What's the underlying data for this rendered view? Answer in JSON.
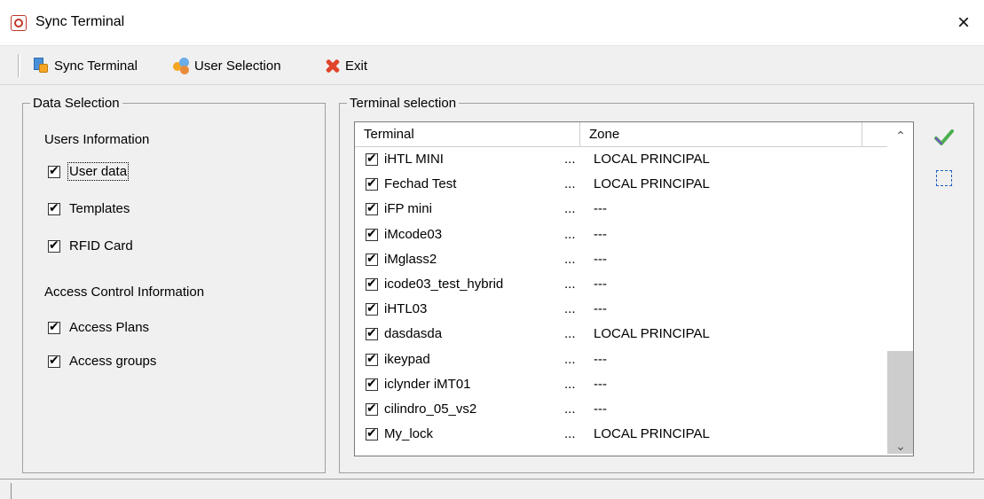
{
  "window": {
    "title": "Sync Terminal",
    "close_glyph": "×"
  },
  "toolbar": {
    "items": [
      {
        "label": "Sync Terminal",
        "icon": "sync-terminal-icon"
      },
      {
        "label": "User Selection",
        "icon": "users-icon"
      },
      {
        "label": "Exit",
        "icon": "exit-icon"
      }
    ]
  },
  "data_selection": {
    "legend": "Data Selection",
    "users_title": "Users Information",
    "users_items": [
      {
        "label": "User data",
        "checked": true
      },
      {
        "label": "Templates",
        "checked": true
      },
      {
        "label": "RFID Card",
        "checked": true
      }
    ],
    "access_title": "Access Control Information",
    "access_items": [
      {
        "label": "Access Plans",
        "checked": true
      },
      {
        "label": "Access groups",
        "checked": true
      }
    ]
  },
  "terminal_selection": {
    "legend": "Terminal selection",
    "columns": [
      "Terminal",
      "Zone"
    ],
    "rows": [
      {
        "name": "iHTL MINI",
        "dots": "...",
        "zone": "LOCAL PRINCIPAL",
        "checked": true
      },
      {
        "name": "Fechad Test",
        "dots": "...",
        "zone": "LOCAL PRINCIPAL",
        "checked": true
      },
      {
        "name": "iFP mini",
        "dots": "...",
        "zone": "---",
        "checked": true
      },
      {
        "name": "iMcode03",
        "dots": "...",
        "zone": "---",
        "checked": true
      },
      {
        "name": "iMglass2",
        "dots": "...",
        "zone": "---",
        "checked": true
      },
      {
        "name": "icode03_test_hybrid",
        "dots": "...",
        "zone": "---",
        "checked": true
      },
      {
        "name": "iHTL03",
        "dots": "...",
        "zone": "---",
        "checked": true
      },
      {
        "name": "dasdasda",
        "dots": "...",
        "zone": "LOCAL PRINCIPAL",
        "checked": true
      },
      {
        "name": "ikeypad",
        "dots": "...",
        "zone": "---",
        "checked": true
      },
      {
        "name": "iclynder iMT01",
        "dots": "...",
        "zone": "---",
        "checked": true
      },
      {
        "name": "cilindro_05_vs2",
        "dots": "...",
        "zone": "---",
        "checked": true
      },
      {
        "name": "My_lock",
        "dots": "...",
        "zone": "LOCAL PRINCIPAL",
        "checked": true
      }
    ]
  },
  "side_buttons": [
    {
      "icon": "check-all-icon",
      "color": "#4caf50"
    },
    {
      "icon": "select-none-icon",
      "color": "#1f5fbf"
    }
  ]
}
